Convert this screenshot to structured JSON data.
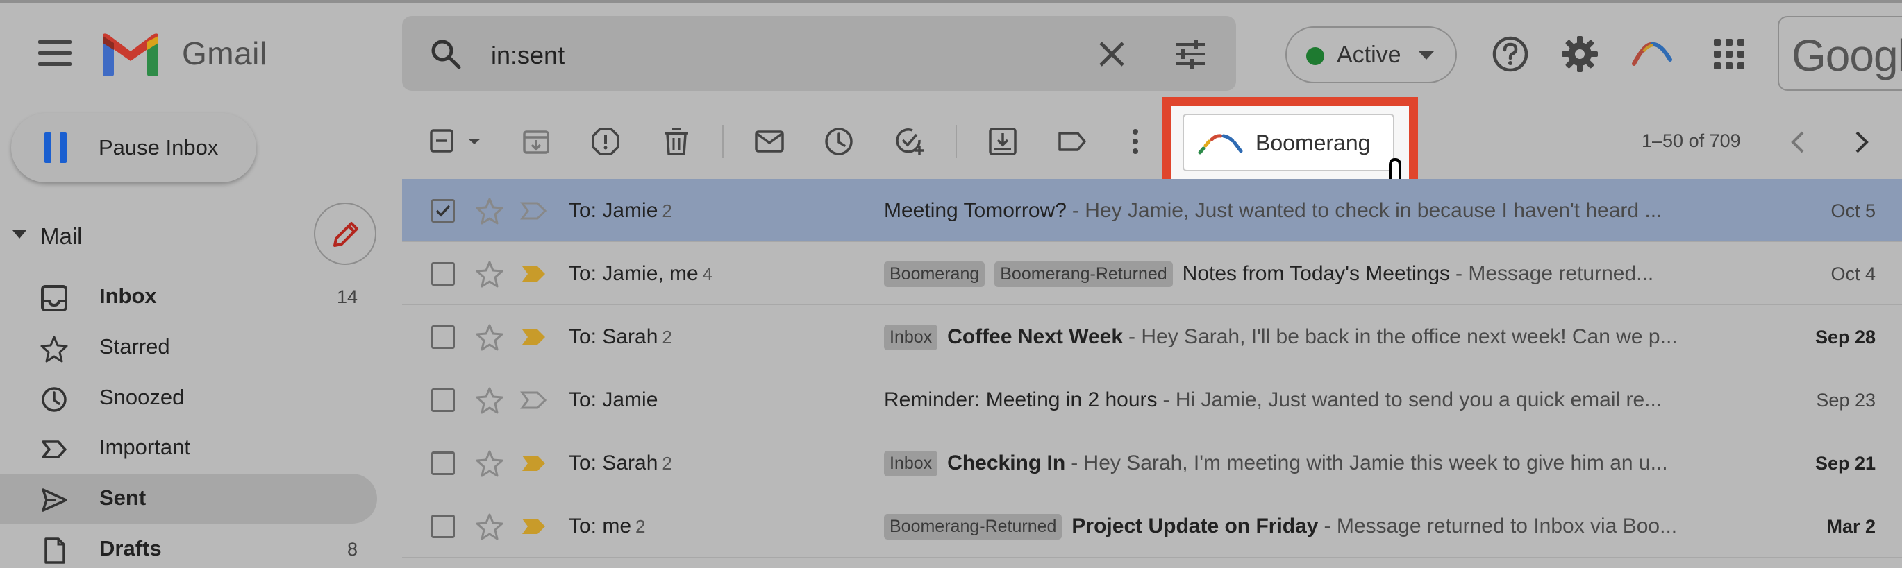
{
  "header": {
    "app_name": "Gmail",
    "search_query": "in:sent",
    "status": "Active",
    "account_word": "Google"
  },
  "sidebar": {
    "pause_label": "Pause Inbox",
    "section_label": "Mail",
    "items": [
      {
        "label": "Inbox",
        "count": "14",
        "bold": true
      },
      {
        "label": "Starred",
        "count": ""
      },
      {
        "label": "Snoozed",
        "count": ""
      },
      {
        "label": "Important",
        "count": ""
      },
      {
        "label": "Sent",
        "count": "",
        "selected": true
      },
      {
        "label": "Drafts",
        "count": "8",
        "bold": true
      }
    ]
  },
  "toolbar": {
    "boomerang_label": "Boomerang",
    "page_range": "1–50 of 709"
  },
  "emails": [
    {
      "sender": "To: Jamie",
      "count": "2",
      "tags": [],
      "subject": "Meeting Tomorrow?",
      "snippet": "- Hey Jamie, Just wanted to check in because I haven't heard ...",
      "date": "Oct 5",
      "selected": true
    },
    {
      "sender": "To: Jamie, me",
      "count": "4",
      "tags": [
        "Boomerang",
        "Boomerang-Returned"
      ],
      "subject": "Notes from Today's Meetings",
      "snippet": "- Message returned...",
      "date": "Oct 4"
    },
    {
      "sender": "To: Sarah",
      "count": "2",
      "tags": [
        "Inbox"
      ],
      "subject": "Coffee Next Week",
      "snippet": "- Hey Sarah, I'll be back in the office next week! Can we p...",
      "date": "Sep 28",
      "bold": true
    },
    {
      "sender": "To: Jamie",
      "count": "",
      "tags": [],
      "subject": "Reminder: Meeting in 2 hours",
      "snippet": "- Hi Jamie, Just wanted to send you a quick email re...",
      "date": "Sep 23"
    },
    {
      "sender": "To: Sarah",
      "count": "2",
      "tags": [
        "Inbox"
      ],
      "subject": "Checking In",
      "snippet": "- Hey Sarah, I'm meeting with Jamie this week to give him an u...",
      "date": "Sep 21",
      "bold": true
    },
    {
      "sender": "To: me",
      "count": "2",
      "tags": [
        "Boomerang-Returned"
      ],
      "subject": "Project Update on Friday",
      "snippet": "- Message returned to Inbox via Boo...",
      "date": "Mar 2",
      "bold": true
    }
  ],
  "colors": {
    "highlight_border": "#e0452c",
    "selected_row": "#8b9bb6",
    "status_dot": "#1e7a30",
    "pause_blue": "#1a5fd0"
  }
}
